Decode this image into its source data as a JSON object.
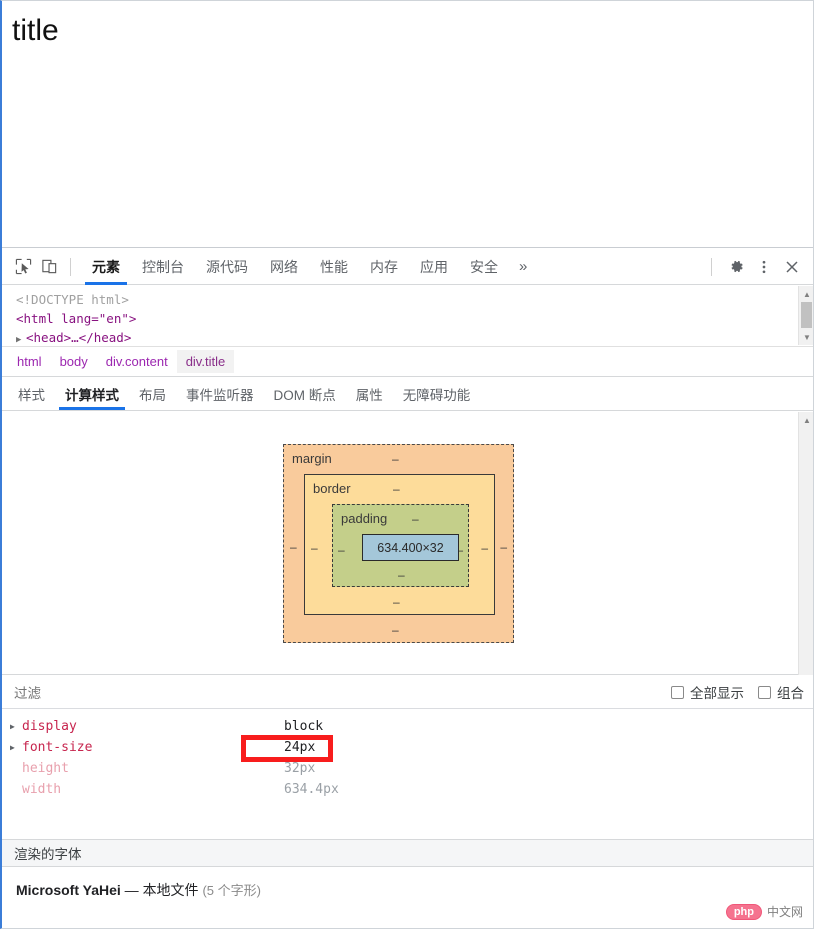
{
  "viewport": {
    "title": "title"
  },
  "toolbar": {
    "inspect_icon": "inspect-cursor-icon",
    "device_icon": "device-toolbar-icon",
    "tabs": [
      {
        "label": "元素",
        "active": true
      },
      {
        "label": "控制台",
        "active": false
      },
      {
        "label": "源代码",
        "active": false
      },
      {
        "label": "网络",
        "active": false
      },
      {
        "label": "性能",
        "active": false
      },
      {
        "label": "内存",
        "active": false
      },
      {
        "label": "应用",
        "active": false
      },
      {
        "label": "安全",
        "active": false
      }
    ],
    "more_label": "»",
    "settings_icon": "gear-icon",
    "menu_icon": "kebab-menu-icon",
    "close_icon": "close-icon"
  },
  "dom": {
    "lines": [
      {
        "text": "<!DOCTYPE html>",
        "kind": "doctype"
      },
      {
        "text": "<html lang=\"en\">",
        "kind": "tag"
      },
      {
        "text": "<head>…</head>",
        "kind": "collapsed"
      }
    ]
  },
  "breadcrumb": {
    "items": [
      {
        "label": "html",
        "selected": false
      },
      {
        "label": "body",
        "selected": false
      },
      {
        "label": "div.content",
        "selected": false
      },
      {
        "label": "div.title",
        "selected": true
      }
    ]
  },
  "sub_tabs": [
    {
      "label": "样式",
      "active": false
    },
    {
      "label": "计算样式",
      "active": true
    },
    {
      "label": "布局",
      "active": false
    },
    {
      "label": "事件监听器",
      "active": false
    },
    {
      "label": "DOM 断点",
      "active": false
    },
    {
      "label": "属性",
      "active": false
    },
    {
      "label": "无障碍功能",
      "active": false
    }
  ],
  "box_model": {
    "margin_label": "margin",
    "margin_value": "–",
    "border_label": "border",
    "border_value": "–",
    "padding_label": "padding",
    "padding_value": "–",
    "content_size": "634.400×32",
    "dash": "–",
    "colors": {
      "margin": "#f9cb9c",
      "border": "#fddc9a",
      "padding": "#c4cf8a",
      "content": "#a4c7d9"
    }
  },
  "filter": {
    "placeholder": "过滤",
    "show_all_label": "全部显示",
    "show_all_checked": false,
    "group_label": "组合",
    "group_checked": false
  },
  "properties": [
    {
      "name": "display",
      "value": "block",
      "expandable": true,
      "inherited": false
    },
    {
      "name": "font-size",
      "value": "24px",
      "expandable": true,
      "inherited": false
    },
    {
      "name": "height",
      "value": "32px",
      "expandable": false,
      "inherited": true
    },
    {
      "name": "width",
      "value": "634.4px",
      "expandable": false,
      "inherited": true
    }
  ],
  "highlight": {
    "target": "font-size",
    "color": "#f81d1d"
  },
  "fonts": {
    "header": "渲染的字体",
    "name": "Microsoft YaHei",
    "separator": "—",
    "source": "本地文件",
    "glyphs": "(5 个字形)"
  },
  "watermark": {
    "badge": "php",
    "text": "中文网"
  }
}
